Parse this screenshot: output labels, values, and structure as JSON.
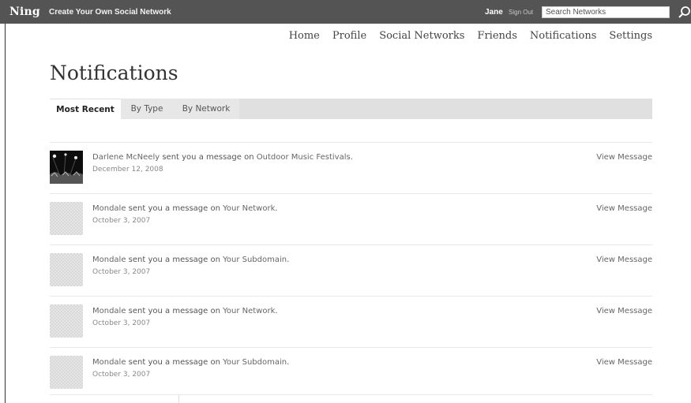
{
  "topbar": {
    "logo": "Ning",
    "create_link": "Create Your Own Social Network",
    "user": "Jane",
    "sign_out": "Sign Out",
    "search_placeholder": "Search Networks",
    "search_icon": "search-icon",
    "bg_color": "#545454"
  },
  "nav": {
    "items": [
      "Home",
      "Profile",
      "Social Networks",
      "Friends",
      "Notifications",
      "Settings"
    ]
  },
  "page": {
    "title": "Notifications"
  },
  "tabs": [
    {
      "label": "Most Recent",
      "active": true
    },
    {
      "label": "By Type",
      "active": false
    },
    {
      "label": "By Network",
      "active": false
    }
  ],
  "notifications": [
    {
      "sender": "Darlene McNeely",
      "action_text": " sent you a message on ",
      "network": "Outdoor Music Festivals",
      "end": ".",
      "date": "December 12, 2008",
      "action": "View Message",
      "avatar": "photo"
    },
    {
      "sender": "Mondale",
      "action_text": " sent you a message on ",
      "network": "Your Network",
      "end": ".",
      "date": "October 3, 2007",
      "action": "View Message",
      "avatar": "placeholder"
    },
    {
      "sender": "Mondale",
      "action_text": " sent you a message on ",
      "network": "Your Subdomain",
      "end": ".",
      "date": "October 3, 2007",
      "action": "View Message",
      "avatar": "placeholder"
    },
    {
      "sender": "Mondale",
      "action_text": " sent you a message on ",
      "network": "Your Network",
      "end": ".",
      "date": "October 3, 2007",
      "action": "View Message",
      "avatar": "placeholder"
    },
    {
      "sender": "Mondale",
      "action_text": " sent you a message on ",
      "network": "Your Subdomain",
      "end": ".",
      "date": "October 3, 2007",
      "action": "View Message",
      "avatar": "placeholder"
    }
  ]
}
